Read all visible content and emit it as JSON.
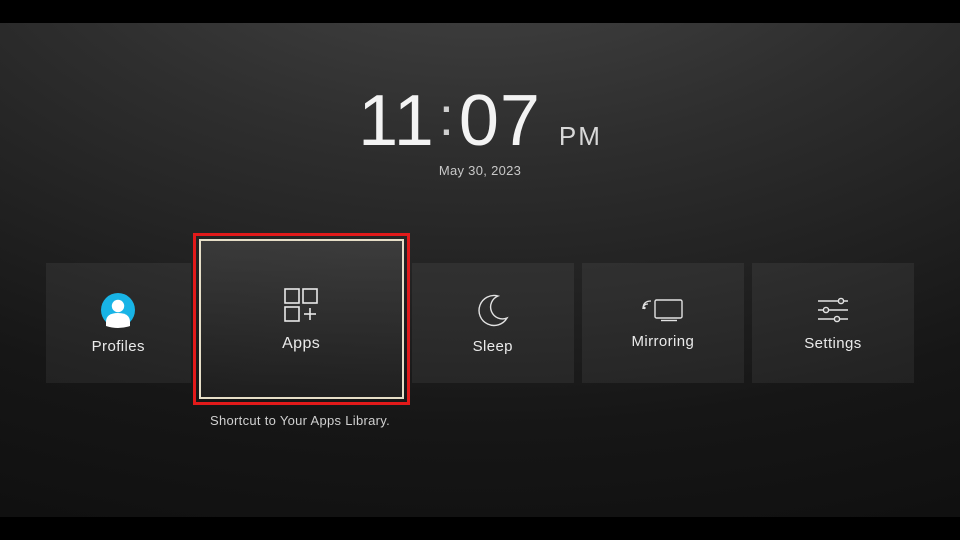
{
  "clock": {
    "hours": "11",
    "minutes": "07",
    "ampm": "PM",
    "date": "May 30, 2023"
  },
  "tiles": {
    "profiles": {
      "label": "Profiles"
    },
    "apps": {
      "label": "Apps",
      "hint": "Shortcut to Your Apps Library."
    },
    "sleep": {
      "label": "Sleep"
    },
    "mirroring": {
      "label": "Mirroring"
    },
    "settings": {
      "label": "Settings"
    }
  }
}
